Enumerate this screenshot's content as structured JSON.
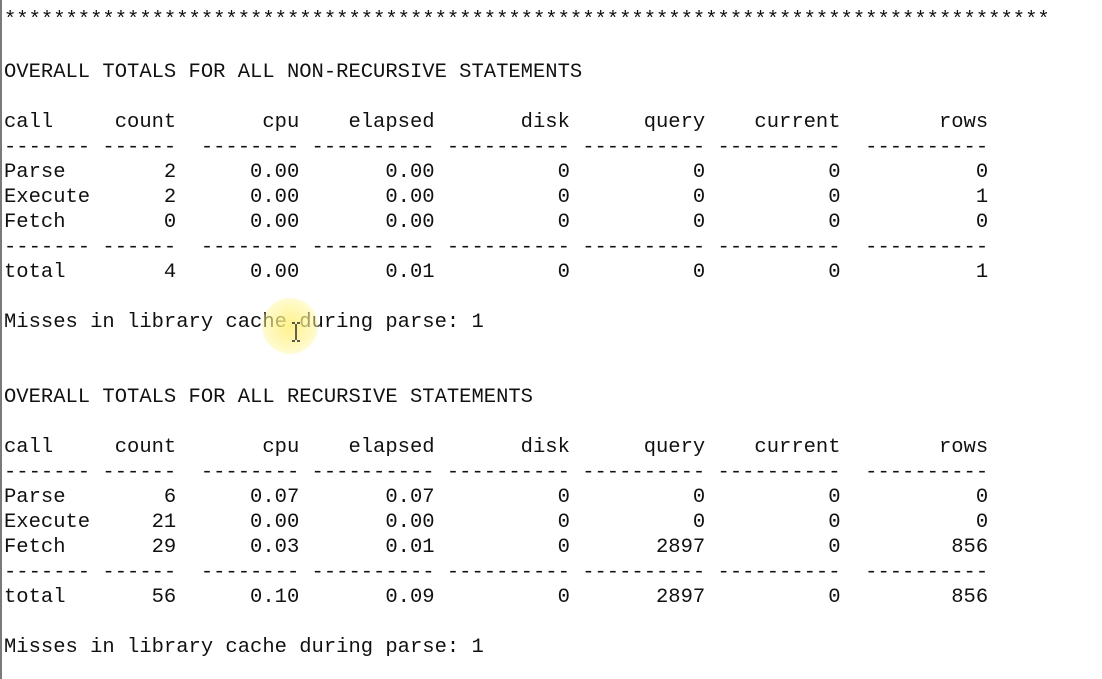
{
  "divider": "*************************************************************************************",
  "sections": [
    {
      "heading": "OVERALL TOTALS FOR ALL NON-RECURSIVE STATEMENTS",
      "header_row": "call     count       cpu    elapsed       disk      query    current        rows",
      "rule_row": "------- ------  -------- ---------- ---------- ---------- ----------  ----------",
      "rows": [
        "Parse        2      0.00       0.00          0          0          0           0",
        "Execute      2      0.00       0.00          0          0          0           1",
        "Fetch        0      0.00       0.00          0          0          0           0"
      ],
      "total_row": "total        4      0.00       0.01          0          0          0           1",
      "misses": "Misses in library cache during parse: 1",
      "table": {
        "columns": [
          "call",
          "count",
          "cpu",
          "elapsed",
          "disk",
          "query",
          "current",
          "rows"
        ],
        "rows": [
          [
            "Parse",
            "2",
            "0.00",
            "0.00",
            "0",
            "0",
            "0",
            "0"
          ],
          [
            "Execute",
            "2",
            "0.00",
            "0.00",
            "0",
            "0",
            "0",
            "1"
          ],
          [
            "Fetch",
            "0",
            "0.00",
            "0.00",
            "0",
            "0",
            "0",
            "0"
          ]
        ],
        "total": [
          "total",
          "4",
          "0.00",
          "0.01",
          "0",
          "0",
          "0",
          "1"
        ]
      }
    },
    {
      "heading": "OVERALL TOTALS FOR ALL RECURSIVE STATEMENTS",
      "header_row": "call     count       cpu    elapsed       disk      query    current        rows",
      "rule_row": "------- ------  -------- ---------- ---------- ---------- ----------  ----------",
      "rows": [
        "Parse        6      0.07       0.07          0          0          0           0",
        "Execute     21      0.00       0.00          0          0          0           0",
        "Fetch       29      0.03       0.01          0       2897          0         856"
      ],
      "total_row": "total       56      0.10       0.09          0       2897          0         856",
      "misses": "Misses in library cache during parse: 1",
      "table": {
        "columns": [
          "call",
          "count",
          "cpu",
          "elapsed",
          "disk",
          "query",
          "current",
          "rows"
        ],
        "rows": [
          [
            "Parse",
            "6",
            "0.07",
            "0.07",
            "0",
            "0",
            "0",
            "0"
          ],
          [
            "Execute",
            "21",
            "0.00",
            "0.00",
            "0",
            "0",
            "0",
            "0"
          ],
          [
            "Fetch",
            "29",
            "0.03",
            "0.01",
            "0",
            "2897",
            "0",
            "856"
          ]
        ],
        "total": [
          "total",
          "56",
          "0.10",
          "0.09",
          "0",
          "2897",
          "0",
          "856"
        ]
      }
    }
  ],
  "cursor": {
    "icon": "text-ibeam-cursor-icon",
    "highlight_color": "#fff07a"
  }
}
